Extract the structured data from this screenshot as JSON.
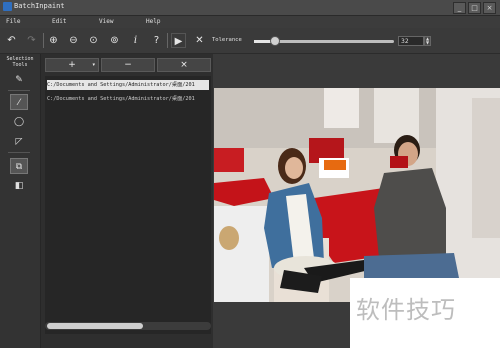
{
  "window": {
    "title": "BatchInpaint"
  },
  "menu": [
    "File",
    "Edit",
    "View",
    "Help"
  ],
  "toolbar": {
    "tolerance_label": "Tolerance",
    "tolerance_value": "32",
    "tolerance_fraction": 0.14
  },
  "selection_tools": {
    "title_line1": "Selection",
    "title_line2": "Tools"
  },
  "file_buttons": {
    "add": "+",
    "remove": "−",
    "clear": "×"
  },
  "files": [
    {
      "path": "C:/Documents and Settings/Administrator/桌面/201",
      "selected": true
    },
    {
      "path": "C:/Documents and Settings/Administrator/桌面/201",
      "selected": false
    }
  ],
  "watermark": "软件技巧"
}
